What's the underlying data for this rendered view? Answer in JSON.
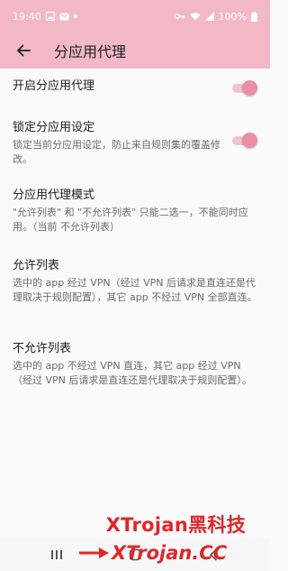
{
  "status_bar": {
    "time": "19:40",
    "left_icons": [
      "image-icon",
      "mail-icon",
      "dot-icon"
    ],
    "right_icons": [
      "key-icon",
      "wifi-icon",
      "signal-icon"
    ],
    "battery": "100%"
  },
  "app_bar": {
    "title": "分应用代理",
    "background": "#f3b8c5"
  },
  "settings": [
    {
      "title": "开启分应用代理",
      "summary": "",
      "toggle": true
    },
    {
      "title": "锁定分应用设定",
      "summary": "锁定当前分应用设定，防止来自规则集的覆盖修改。",
      "toggle": true
    },
    {
      "title": "分应用代理模式",
      "summary": "\"允许列表\" 和 \"不允许列表\" 只能二选一，不能同时应用。（当前 不允许列表）",
      "toggle": false
    },
    {
      "title": "允许列表",
      "summary": "选中的 app 经过 VPN（经过 VPN 后请求是直连还是代理取决于规则配置），其它 app 不经过 VPN 全部直连。",
      "toggle": false
    },
    {
      "title": "不允许列表",
      "summary": "选中的 app 不经过 VPN 直连，其它 app 经过 VPN（经过 VPN 后请求是直连还是代理取决于规则配置）。",
      "toggle": false
    }
  ],
  "watermark": {
    "brand": "XTrojan黑科技",
    "url": "XTrojan.CC",
    "color": "#e0262a"
  },
  "nav_bar": {
    "buttons": [
      "recents-icon",
      "home-icon",
      "back-icon"
    ]
  }
}
